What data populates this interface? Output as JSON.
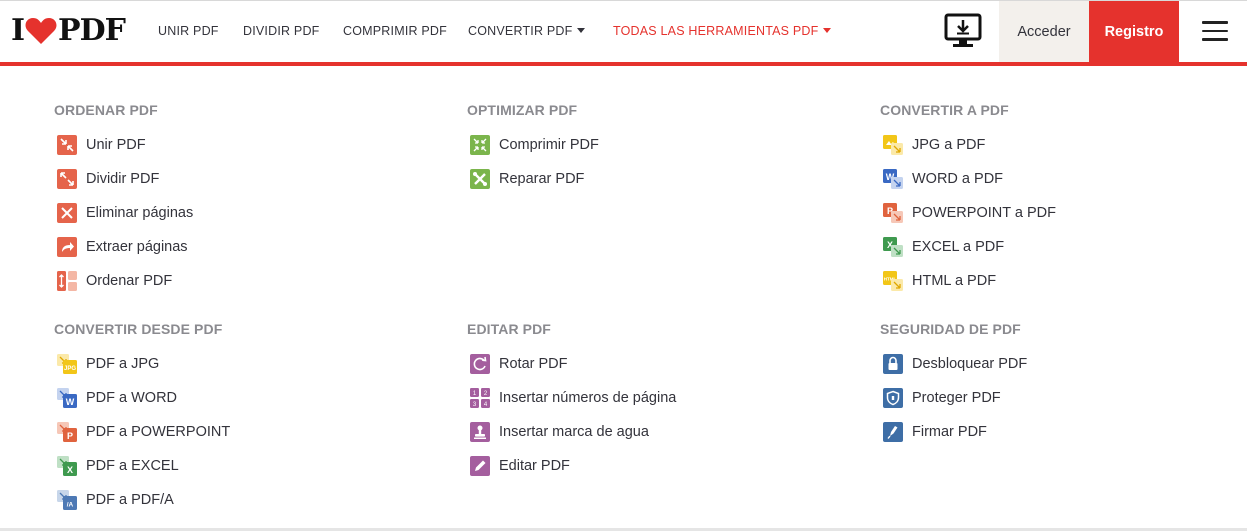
{
  "header": {
    "logo_left": "I",
    "logo_right": "PDF",
    "nav": [
      {
        "label": "UNIR PDF"
      },
      {
        "label": "DIVIDIR PDF"
      },
      {
        "label": "COMPRIMIR PDF"
      },
      {
        "label": "CONVERTIR PDF"
      },
      {
        "label": "TODAS LAS HERRAMIENTAS PDF"
      }
    ],
    "login_label": "Acceder",
    "register_label": "Registro"
  },
  "colors": {
    "brand_red": "#e5322d",
    "organize": "#e5644b",
    "optimize": "#7bb54c",
    "edit": "#a45e9e",
    "security": "#3e6ea6",
    "jpg_yellow": "#f2c618",
    "word_blue": "#3a69c3",
    "ppt_orange": "#e0633e",
    "excel_green": "#3f9a4f",
    "pdfa_blue": "#4d79b5"
  },
  "menu": {
    "organize": {
      "title": "ORDENAR PDF",
      "items": [
        {
          "label": "Unir PDF",
          "icon": "merge-icon"
        },
        {
          "label": "Dividir PDF",
          "icon": "split-icon"
        },
        {
          "label": "Eliminar páginas",
          "icon": "remove-pages-icon"
        },
        {
          "label": "Extraer páginas",
          "icon": "extract-pages-icon"
        },
        {
          "label": "Ordenar PDF",
          "icon": "organize-icon"
        }
      ]
    },
    "optimize": {
      "title": "OPTIMIZAR PDF",
      "items": [
        {
          "label": "Comprimir PDF",
          "icon": "compress-icon"
        },
        {
          "label": "Reparar PDF",
          "icon": "repair-icon"
        }
      ]
    },
    "convert_to": {
      "title": "CONVERTIR A PDF",
      "items": [
        {
          "label": "JPG a PDF",
          "icon": "jpg-to-pdf-icon"
        },
        {
          "label": "WORD a PDF",
          "icon": "word-to-pdf-icon"
        },
        {
          "label": "POWERPOINT a PDF",
          "icon": "powerpoint-to-pdf-icon"
        },
        {
          "label": "EXCEL a PDF",
          "icon": "excel-to-pdf-icon"
        },
        {
          "label": "HTML a PDF",
          "icon": "html-to-pdf-icon"
        }
      ]
    },
    "convert_from": {
      "title": "CONVERTIR DESDE PDF",
      "items": [
        {
          "label": "PDF a JPG",
          "icon": "pdf-to-jpg-icon"
        },
        {
          "label": "PDF a WORD",
          "icon": "pdf-to-word-icon"
        },
        {
          "label": "PDF a POWERPOINT",
          "icon": "pdf-to-powerpoint-icon"
        },
        {
          "label": "PDF a EXCEL",
          "icon": "pdf-to-excel-icon"
        },
        {
          "label": "PDF a PDF/A",
          "icon": "pdf-to-pdfa-icon"
        }
      ]
    },
    "edit": {
      "title": "EDITAR PDF",
      "items": [
        {
          "label": "Rotar PDF",
          "icon": "rotate-icon"
        },
        {
          "label": "Insertar números de página",
          "icon": "page-numbers-icon"
        },
        {
          "label": "Insertar marca de agua",
          "icon": "watermark-icon"
        },
        {
          "label": "Editar PDF",
          "icon": "edit-icon"
        }
      ]
    },
    "security": {
      "title": "SEGURIDAD DE PDF",
      "items": [
        {
          "label": "Desbloquear PDF",
          "icon": "unlock-icon"
        },
        {
          "label": "Proteger PDF",
          "icon": "protect-icon"
        },
        {
          "label": "Firmar PDF",
          "icon": "sign-icon"
        }
      ]
    }
  }
}
